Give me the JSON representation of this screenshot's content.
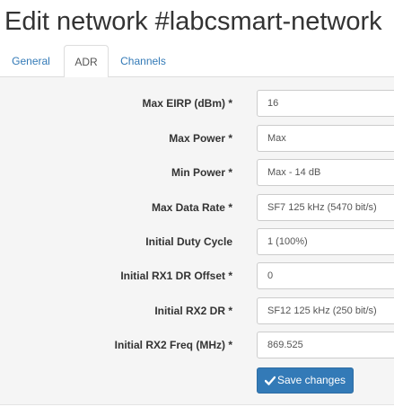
{
  "page": {
    "title": "Edit network #labcsmart-network"
  },
  "tabs": [
    {
      "label": "General",
      "active": false
    },
    {
      "label": "ADR",
      "active": true
    },
    {
      "label": "Channels",
      "active": false
    }
  ],
  "form": {
    "fields": [
      {
        "label": "Max EIRP (dBm) *",
        "value": "16"
      },
      {
        "label": "Max Power *",
        "value": "Max"
      },
      {
        "label": "Min Power *",
        "value": "Max - 14 dB"
      },
      {
        "label": "Max Data Rate *",
        "value": "SF7 125 kHz (5470 bit/s)"
      },
      {
        "label": "Initial Duty Cycle",
        "value": "1 (100%)"
      },
      {
        "label": "Initial RX1 DR Offset *",
        "value": "0"
      },
      {
        "label": "Initial RX2 DR *",
        "value": "SF12 125 kHz (250 bit/s)"
      },
      {
        "label": "Initial RX2 Freq (MHz) *",
        "value": "869.525"
      }
    ],
    "save_label": "Save changes",
    "save_icon": "check-icon"
  },
  "colors": {
    "accent": "#337ab7",
    "link": "#337ab7",
    "panel_bg": "#f5f5f5"
  }
}
